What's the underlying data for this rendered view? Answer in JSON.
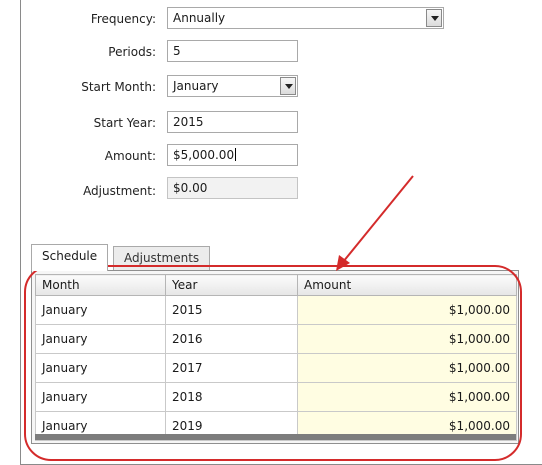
{
  "form": {
    "frequency": {
      "label": "Frequency:",
      "value": "Annually"
    },
    "periods": {
      "label": "Periods:",
      "value": "5"
    },
    "start_month": {
      "label": "Start Month:",
      "value": "January"
    },
    "start_year": {
      "label": "Start Year:",
      "value": "2015"
    },
    "amount": {
      "label": "Amount:",
      "value": "$5,000.00"
    },
    "adjustment": {
      "label": "Adjustment:",
      "value": "$0.00"
    }
  },
  "tabs": [
    {
      "label": "Schedule",
      "active": true
    },
    {
      "label": "Adjustments",
      "active": false
    }
  ],
  "schedule": {
    "columns": [
      "Month",
      "Year",
      "Amount"
    ],
    "rows": [
      {
        "month": "January",
        "year": "2015",
        "amount": "$1,000.00"
      },
      {
        "month": "January",
        "year": "2016",
        "amount": "$1,000.00"
      },
      {
        "month": "January",
        "year": "2017",
        "amount": "$1,000.00"
      },
      {
        "month": "January",
        "year": "2018",
        "amount": "$1,000.00"
      },
      {
        "month": "January",
        "year": "2019",
        "amount": "$1,000.00"
      }
    ]
  },
  "colors": {
    "annotation": "#d42b2b",
    "amount_cell_bg": "#fffde2"
  },
  "icons": {
    "dropdown": "chevron-down-icon",
    "annotation_arrow": "arrow-icon"
  }
}
